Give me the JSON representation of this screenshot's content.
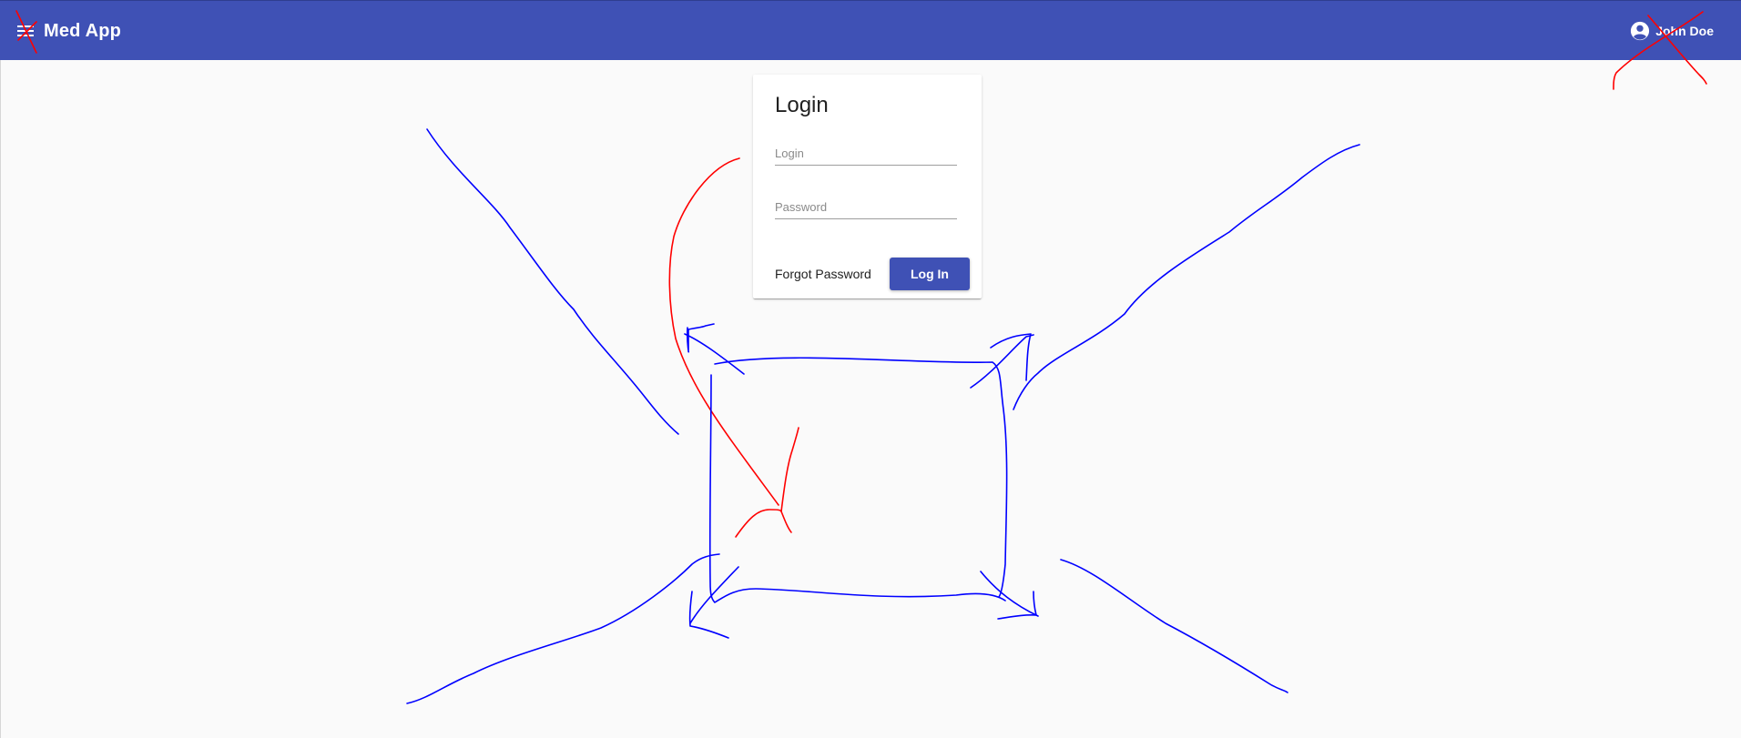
{
  "toolbar": {
    "app_title": "Med App",
    "user_name": "John Doe",
    "color": "#3f51b5",
    "menu_icon": "menu-icon",
    "user_icon": "account-circle-icon"
  },
  "login_card": {
    "title": "Login",
    "login_field": {
      "placeholder": "Login",
      "value": ""
    },
    "password_field": {
      "placeholder": "Password",
      "value": ""
    },
    "forgot_password_label": "Forgot Password",
    "login_button_label": "Log In"
  },
  "annotations": {
    "description": "hand-drawn red and blue pen strokes overlaying the page",
    "colors": {
      "red": "#ff0000",
      "blue": "#0000ff"
    }
  }
}
